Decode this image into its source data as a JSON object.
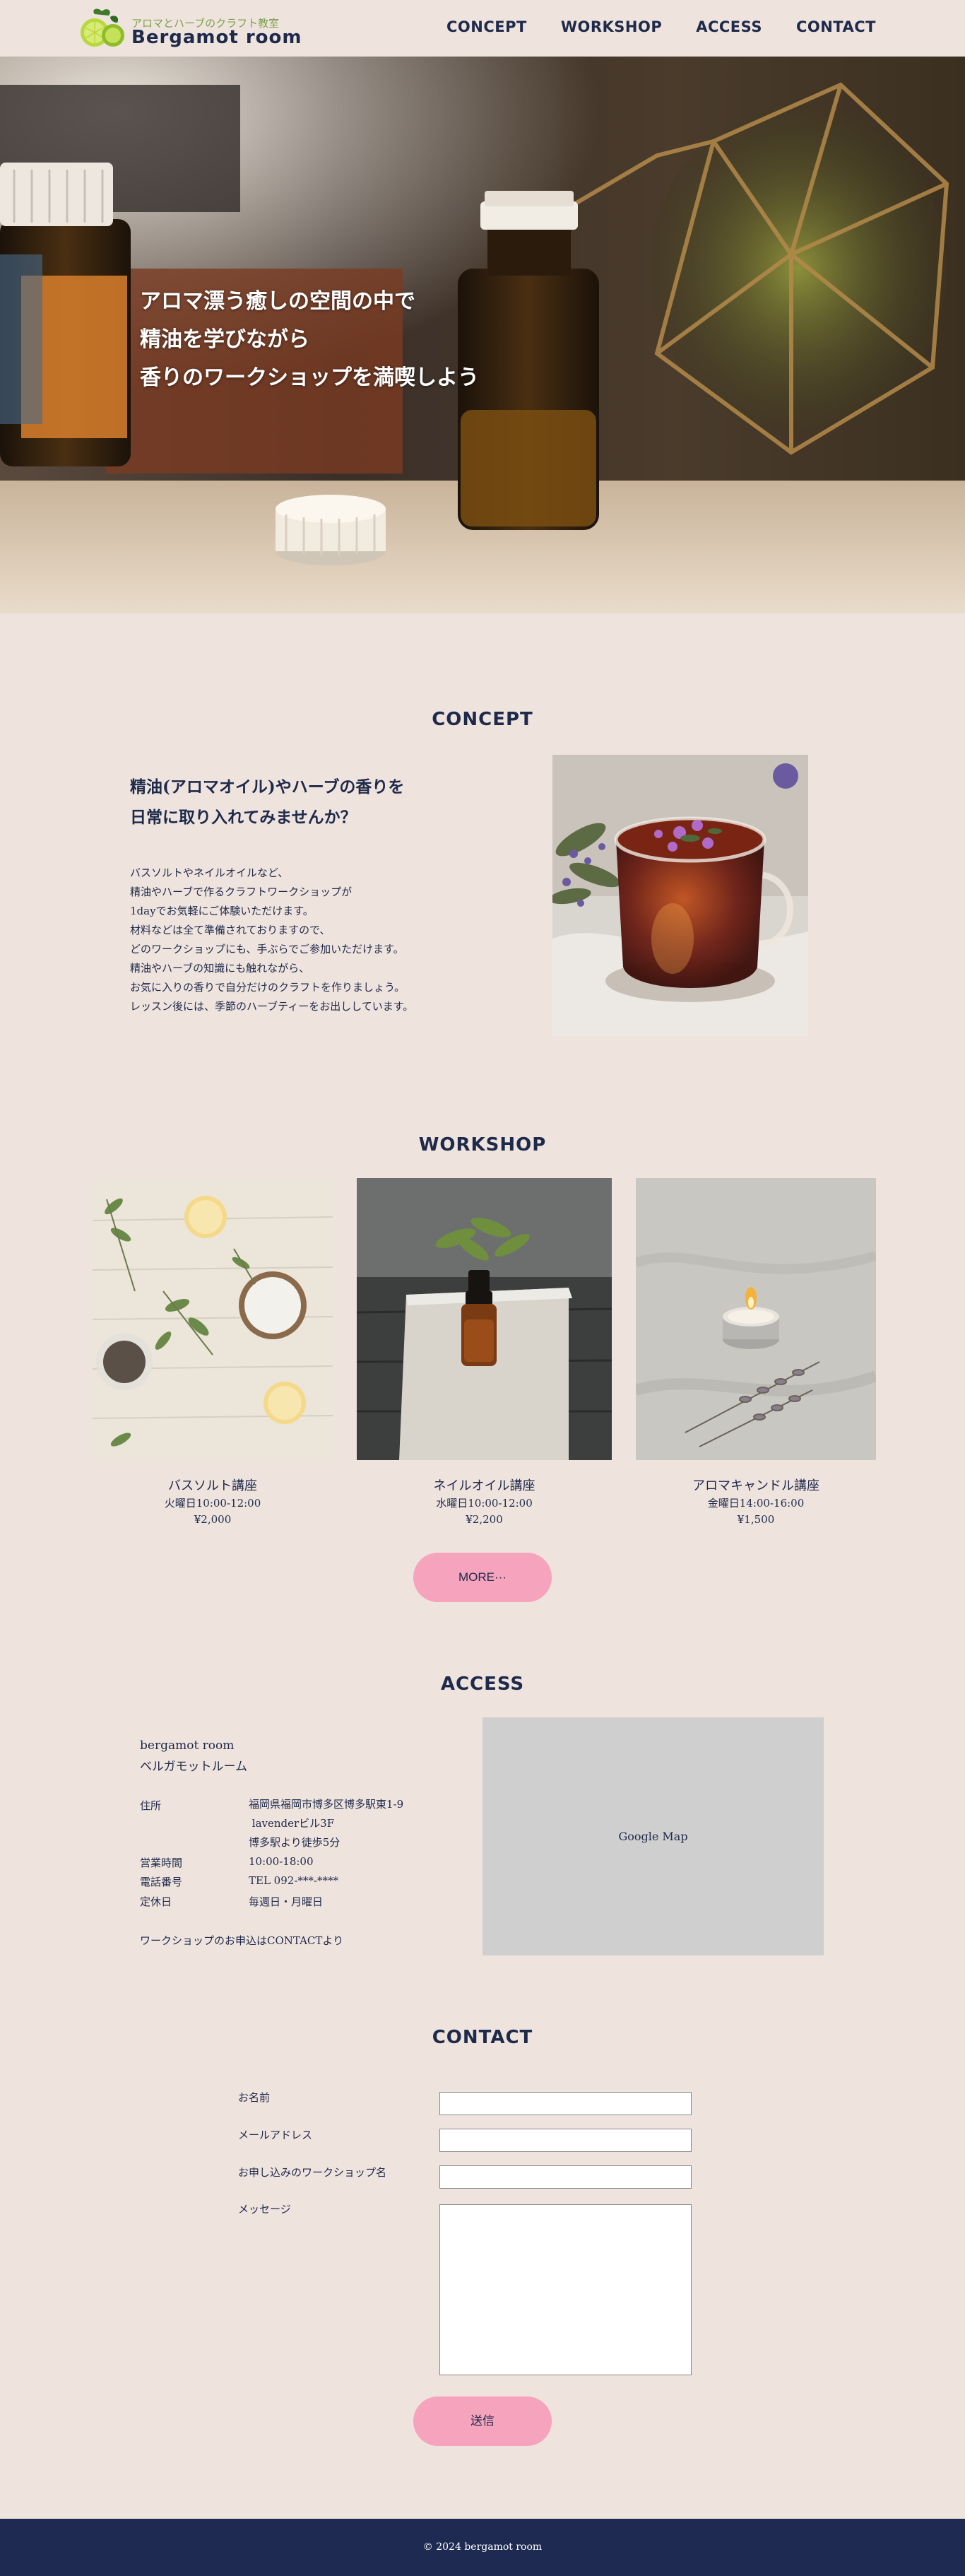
{
  "header": {
    "logo_sub": "アロマとハーブのクラフト教室",
    "logo_main": "Bergamot room",
    "nav": [
      "CONCEPT",
      "WORKSHOP",
      "ACCESS",
      "CONTACT"
    ]
  },
  "hero": {
    "lines": [
      "アロマ漂う癒しの空間の中で",
      "精油を学びながら",
      "香りのワークショップを満喫しよう"
    ]
  },
  "concept": {
    "title": "CONCEPT",
    "heading_lines": [
      "精油(アロマオイル)やハーブの香りを",
      "日常に取り入れてみませんか？"
    ],
    "body_lines": [
      "バスソルトやネイルオイルなど、",
      "精油やハーブで作るクラフトワークショップが",
      "1dayでお気軽にご体験いただけます。",
      "材料などは全て準備されておりますので、",
      "どのワークショップにも、手ぶらでご参加いただけます。",
      "精油やハーブの知識にも触れながら、",
      "お気に入りの香りで自分だけのクラフトを作りましょう。",
      "レッスン後には、季節のハーブティーをお出ししています。"
    ]
  },
  "workshop": {
    "title": "WORKSHOP",
    "items": [
      {
        "name": "バスソルト講座",
        "time": "火曜日10:00-12:00",
        "price": "¥2,000"
      },
      {
        "name": "ネイルオイル講座",
        "time": "水曜日10:00-12:00",
        "price": "¥2,200"
      },
      {
        "name": "アロマキャンドル講座",
        "time": "金曜日14:00-16:00",
        "price": "¥1,500"
      }
    ],
    "more_label": "MORE···"
  },
  "access": {
    "title": "ACCESS",
    "name_en": "bergamot room",
    "name_ja": "ベルガモットルーム",
    "address_label": "住所",
    "address_lines": [
      "福岡県福岡市博多区博多駅東1-9",
      " lavenderビル3F",
      "博多駅より徒歩5分"
    ],
    "hours_label": "営業時間",
    "hours": "10:00-18:00",
    "tel_label": "電話番号",
    "tel": "TEL 092-***-****",
    "closed_label": "定休日",
    "closed": "毎週日・月曜日",
    "note": "ワークショップのお申込はCONTACTより",
    "map_label": "Google Map"
  },
  "contact": {
    "title": "CONTACT",
    "name_label": "お名前",
    "email_label": "メールアドレス",
    "workshop_label": "お申し込みのワークショップ名",
    "message_label": "メッセージ",
    "submit_label": "送信"
  },
  "footer": {
    "copyright": "© 2024 bergamot room"
  }
}
